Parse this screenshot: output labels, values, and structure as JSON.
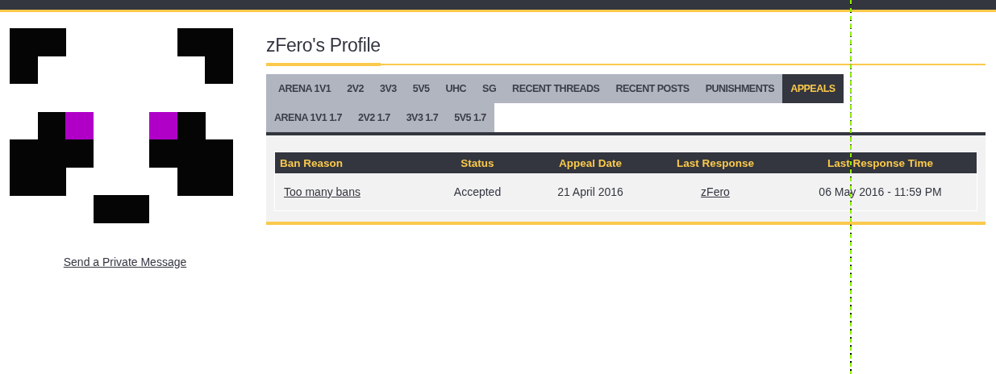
{
  "profile": {
    "title": "zFero's Profile",
    "message_link": "Send a Private Message"
  },
  "tabs": [
    {
      "label": "ARENA 1V1",
      "selected": false
    },
    {
      "label": "2V2",
      "selected": false
    },
    {
      "label": "3V3",
      "selected": false
    },
    {
      "label": "5V5",
      "selected": false
    },
    {
      "label": "UHC",
      "selected": false
    },
    {
      "label": "SG",
      "selected": false
    },
    {
      "label": "RECENT THREADS",
      "selected": false
    },
    {
      "label": "RECENT POSTS",
      "selected": false
    },
    {
      "label": "PUNISHMENTS",
      "selected": false
    },
    {
      "label": "APPEALS",
      "selected": true
    },
    {
      "label": "ARENA 1V1 1.7",
      "selected": false
    },
    {
      "label": "2V2 1.7",
      "selected": false
    },
    {
      "label": "3V3 1.7",
      "selected": false
    },
    {
      "label": "5V5 1.7",
      "selected": false
    }
  ],
  "table": {
    "columns": [
      "Ban Reason",
      "Status",
      "Appeal Date",
      "Last Response",
      "Last Response Time"
    ],
    "rows": [
      {
        "ban_reason": "Too many bans",
        "status": "Accepted",
        "appeal_date": "21 April 2016",
        "last_response": "zFero",
        "last_response_time": "06 May 2016 - 11:59 PM"
      }
    ]
  }
}
